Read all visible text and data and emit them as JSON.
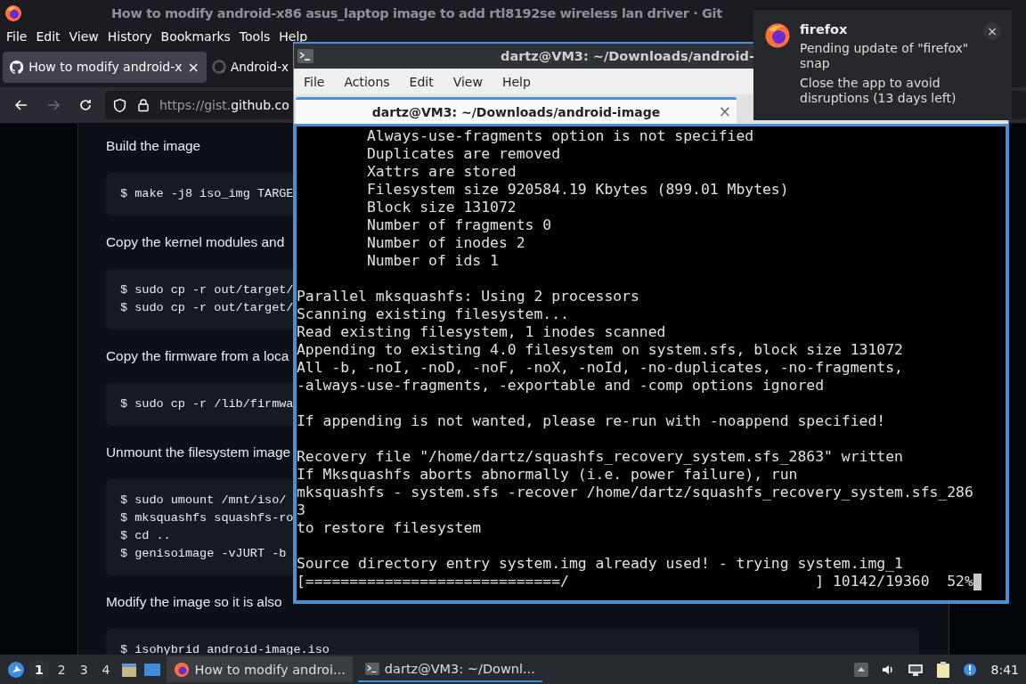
{
  "browser": {
    "window_title": "How to modify android-x86 asus_laptop image to add rtl8192se wireless lan driver · Git",
    "menu": [
      "File",
      "Edit",
      "View",
      "History",
      "Bookmarks",
      "Tools",
      "Help"
    ],
    "tabs": [
      {
        "title": "How to modify android-x",
        "selected": true,
        "close": "×",
        "kind": "github"
      },
      {
        "title": "Android-x",
        "selected": false,
        "kind": "loading"
      }
    ],
    "nav": {
      "back_disabled": false,
      "forward_disabled": true,
      "url_prefix": "https://gist.",
      "url_domain": "github.co"
    },
    "content": [
      {
        "kind": "para",
        "text": "Build the image"
      },
      {
        "kind": "code",
        "lines": [
          "$ make -j8 iso_img TARGE"
        ]
      },
      {
        "kind": "para",
        "text": "Copy the kernel modules and"
      },
      {
        "kind": "code",
        "lines": [
          "$ sudo cp -r out/target/",
          "$ sudo cp -r out/target/"
        ]
      },
      {
        "kind": "para",
        "text": "Copy the firmware from a loca"
      },
      {
        "kind": "code",
        "lines": [
          "$ sudo cp -r /lib/firmwa"
        ]
      },
      {
        "kind": "para",
        "text": "Unmount the filesystem image"
      },
      {
        "kind": "code",
        "lines": [
          "$ sudo umount /mnt/iso/",
          "$ mksquashfs squashfs-ro",
          "$ cd ..",
          "$ genisoimage -vJURT -b"
        ]
      },
      {
        "kind": "para",
        "text": "Modify the image so it is also"
      },
      {
        "kind": "code",
        "lines": [
          "$ isohybrid android-image.iso"
        ]
      }
    ]
  },
  "terminal": {
    "window_title": "dartz@VM3: ~/Downloads/android-",
    "menu": [
      "File",
      "Actions",
      "Edit",
      "View",
      "Help"
    ],
    "tab": {
      "title": "dartz@VM3: ~/Downloads/android-image",
      "close": "×"
    },
    "blocks": [
      [
        "        Always-use-fragments option is not specified",
        "        Duplicates are removed",
        "        Xattrs are stored",
        "        Filesystem size 920584.19 Kbytes (899.01 Mbytes)",
        "        Block size 131072",
        "        Number of fragments 0",
        "        Number of inodes 2",
        "        Number of ids 1"
      ],
      [
        "Parallel mksquashfs: Using 2 processors",
        "Scanning existing filesystem...",
        "Read existing filesystem, 1 inodes scanned",
        "Appending to existing 4.0 filesystem on system.sfs, block size 131072",
        "All -b, -noI, -noD, -noF, -noX, -noId, -no-duplicates, -no-fragments,",
        "-always-use-fragments, -exportable and -comp options ignored"
      ],
      [
        "If appending is not wanted, please re-run with -noappend specified!"
      ],
      [
        "Recovery file \"/home/dartz/squashfs_recovery_system.sfs_2863\" written",
        "If Mksquashfs aborts abnormally (i.e. power failure), run",
        "mksquashfs - system.sfs -recover /home/dartz/squashfs_recovery_system.sfs_286",
        "3",
        "to restore filesystem"
      ],
      [
        "Source directory entry system.img already used! - trying system.img_1",
        "[=============================/                            ] 10142/19360  52%"
      ]
    ],
    "cursor": true
  },
  "notification": {
    "app": "firefox",
    "lines": [
      "Pending update of \"firefox\" snap",
      "Close the app to avoid disruptions (13 days left)"
    ],
    "close": "×"
  },
  "taskbar": {
    "workspaces": [
      {
        "label": "1",
        "selected": true
      },
      {
        "label": "2",
        "selected": false
      },
      {
        "label": "3",
        "selected": false
      },
      {
        "label": "4",
        "selected": false
      }
    ],
    "tasks": [
      {
        "kind": "firefox",
        "label": "How to modify androi...",
        "selected": false
      },
      {
        "kind": "terminal",
        "label": "dartz@VM3: ~/Downl...",
        "selected": true
      }
    ],
    "clock": "8:41"
  }
}
